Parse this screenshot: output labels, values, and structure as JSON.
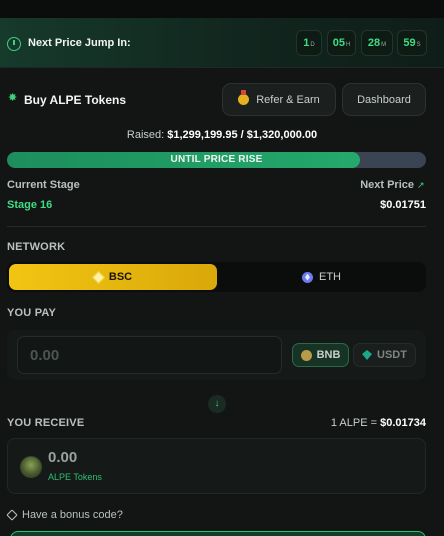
{
  "header": {
    "label": "Next Price Jump In:",
    "timer": [
      {
        "value": "1",
        "unit": "D"
      },
      {
        "value": "05",
        "unit": "H"
      },
      {
        "value": "28",
        "unit": "M"
      },
      {
        "value": "59",
        "unit": "S"
      }
    ]
  },
  "buy": {
    "title": "Buy ALPE Tokens",
    "refer_label": "Refer & Earn",
    "dashboard_label": "Dashboard"
  },
  "raised": {
    "prefix": "Raised:",
    "amount": "$1,299,199.95 / $1,320,000.00"
  },
  "progress": {
    "label": "UNTIL PRICE RISE",
    "fraction": 0.843,
    "fill_color": "#1c8e5c",
    "track_color": "#3b4452"
  },
  "stage": {
    "label": "Current Stage",
    "value": "Stage 16"
  },
  "next_price": {
    "label": "Next Price",
    "value": "$0.01751"
  },
  "network": {
    "label": "NETWORK",
    "options": [
      {
        "label": "BSC",
        "selected": true,
        "icon": "bsc-icon"
      },
      {
        "label": "ETH",
        "selected": false,
        "icon": "eth-icon"
      }
    ]
  },
  "pay": {
    "label": "YOU PAY",
    "placeholder": "0.00",
    "tokens": [
      {
        "label": "BNB",
        "selected": true
      },
      {
        "label": "USDT",
        "selected": false
      }
    ]
  },
  "receive": {
    "label": "YOU RECEIVE",
    "rate_prefix": "1 ALPE =",
    "rate_value": "$0.01734",
    "amount": "0.00",
    "token_name": "ALPE Tokens"
  },
  "bonus": {
    "label": "Have a bonus code?"
  },
  "colors": {
    "accent_green": "#3fdc84",
    "bsc_yellow": "#f2c512",
    "background": "#121514"
  }
}
